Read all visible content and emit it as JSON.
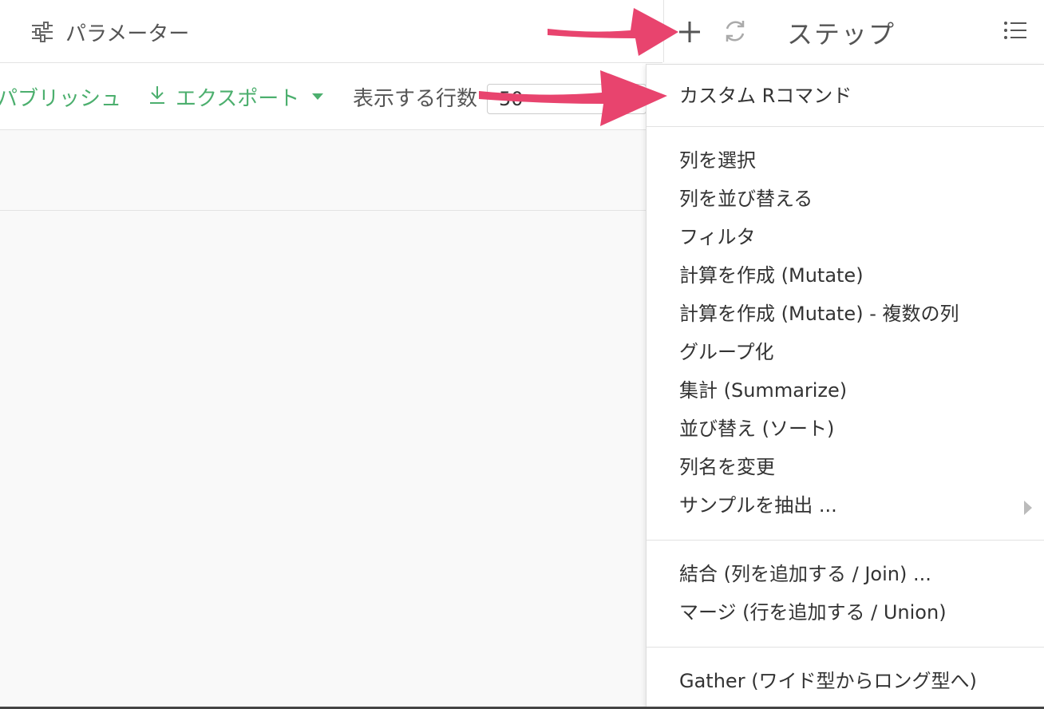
{
  "header": {
    "parameters_label": "パラメーター"
  },
  "toolbar": {
    "publish_label": "パブリッシュ",
    "export_label": "エクスポート",
    "rows_label": "表示する行数",
    "rows_value": "50"
  },
  "steps_panel": {
    "title": "ステップ"
  },
  "menu": {
    "custom": "カスタム Rコマンド",
    "group1": [
      "列を選択",
      "列を並び替える",
      "フィルタ",
      "計算を作成 (Mutate)",
      "計算を作成 (Mutate) - 複数の列",
      "グループ化",
      "集計 (Summarize)",
      "並び替え (ソート)",
      "列名を変更",
      "サンプルを抽出 ..."
    ],
    "group2": [
      "結合 (列を追加する / Join) ...",
      "マージ (行を追加する / Union)"
    ],
    "group3": [
      "Gather (ワイド型からロング型へ)"
    ]
  },
  "colors": {
    "accent_green": "#4caf6e",
    "arrow_pink": "#e8446e"
  },
  "icons": [
    "sliders-icon",
    "download-icon",
    "plus-icon",
    "refresh-icon",
    "list-icon",
    "chevron-right-icon"
  ]
}
